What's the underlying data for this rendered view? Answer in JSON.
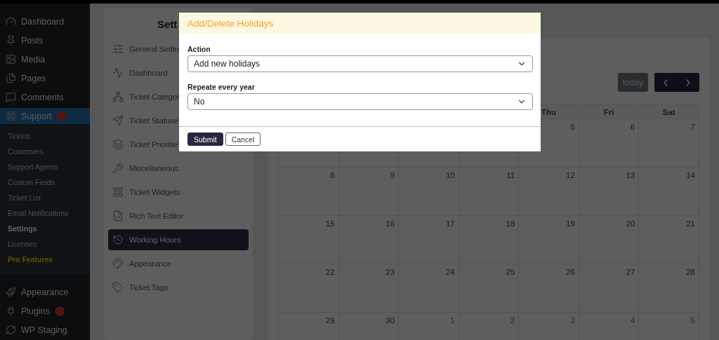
{
  "admin_menu": {
    "items": [
      {
        "label": "Dashboard",
        "kind": "top",
        "selected": false,
        "badge": false
      },
      {
        "label": "Posts",
        "kind": "top",
        "selected": false,
        "badge": false
      },
      {
        "label": "Media",
        "kind": "top",
        "selected": false,
        "badge": false
      },
      {
        "label": "Pages",
        "kind": "top",
        "selected": false,
        "badge": false
      },
      {
        "label": "Comments",
        "kind": "top",
        "selected": false,
        "badge": false
      },
      {
        "label": "Support",
        "kind": "top",
        "selected": true,
        "badge": true
      },
      {
        "label": "Tickets",
        "kind": "sub",
        "selected": false
      },
      {
        "label": "Customers",
        "kind": "sub",
        "selected": false
      },
      {
        "label": "Support Agents",
        "kind": "sub",
        "selected": false
      },
      {
        "label": "Custom Fields",
        "kind": "sub",
        "selected": false
      },
      {
        "label": "Ticket List",
        "kind": "sub",
        "selected": false
      },
      {
        "label": "Email Notifications",
        "kind": "sub",
        "selected": false
      },
      {
        "label": "Settings",
        "kind": "sub",
        "selected": true
      },
      {
        "label": "Licenses",
        "kind": "sub",
        "selected": false
      },
      {
        "label": "Pro Features",
        "kind": "pro",
        "selected": false
      },
      {
        "label": "Appearance",
        "kind": "top",
        "selected": false,
        "badge": false
      },
      {
        "label": "Plugins",
        "kind": "top",
        "selected": false,
        "badge": true
      },
      {
        "label": "WP Staging",
        "kind": "top",
        "selected": false,
        "badge": false
      }
    ]
  },
  "settings_panel": {
    "title": "Sett",
    "items": [
      {
        "label": "General Settin",
        "selected": false
      },
      {
        "label": "Dashboard",
        "selected": false
      },
      {
        "label": "Ticket Categor",
        "selected": false
      },
      {
        "label": "Ticket Statuse",
        "selected": false
      },
      {
        "label": "Ticket Prioritie",
        "selected": false
      },
      {
        "label": "Miscellaneous",
        "selected": false
      },
      {
        "label": "Ticket Widgets",
        "selected": false
      },
      {
        "label": "Rich Text Editor",
        "selected": false
      },
      {
        "label": "Working Hours",
        "selected": true
      },
      {
        "label": "Appearance",
        "selected": false
      },
      {
        "label": "Ticket Tags",
        "selected": false
      }
    ]
  },
  "calendar": {
    "today_button": "today",
    "weekdays": [
      "Thu",
      "Fri",
      "Sat"
    ],
    "weeks": [
      {
        "days": [
          {
            "label": "5",
            "faded": false
          },
          {
            "label": "6",
            "faded": false
          },
          {
            "label": "7",
            "faded": false
          }
        ]
      },
      {
        "days": [
          {
            "label": "8",
            "faded": false
          },
          {
            "label": "9",
            "faded": false
          },
          {
            "label": "10",
            "faded": false
          },
          {
            "label": "11",
            "faded": false
          },
          {
            "label": "12",
            "faded": false
          },
          {
            "label": "13",
            "faded": false
          },
          {
            "label": "14",
            "faded": false
          }
        ]
      },
      {
        "days": [
          {
            "label": "15",
            "faded": false
          },
          {
            "label": "16",
            "faded": false
          },
          {
            "label": "17",
            "faded": false
          },
          {
            "label": "18",
            "faded": false
          },
          {
            "label": "19",
            "faded": false
          },
          {
            "label": "20",
            "faded": false
          },
          {
            "label": "21",
            "faded": false
          }
        ]
      },
      {
        "days": [
          {
            "label": "22",
            "faded": false
          },
          {
            "label": "23",
            "faded": false
          },
          {
            "label": "24",
            "faded": false
          },
          {
            "label": "25",
            "faded": false
          },
          {
            "label": "26",
            "faded": false
          },
          {
            "label": "27",
            "faded": false
          },
          {
            "label": "28",
            "faded": false
          }
        ]
      },
      {
        "days": [
          {
            "label": "29",
            "faded": false
          },
          {
            "label": "30",
            "faded": false
          },
          {
            "label": "1",
            "faded": true
          },
          {
            "label": "2",
            "faded": true
          },
          {
            "label": "3",
            "faded": true
          },
          {
            "label": "4",
            "faded": true
          },
          {
            "label": "5",
            "faded": true
          }
        ]
      }
    ]
  },
  "dialog": {
    "title": "Add/Delete Holidays",
    "fields": [
      {
        "label": "Action",
        "value": "Add new holidays"
      },
      {
        "label": "Repeate every year",
        "value": "No"
      }
    ],
    "buttons": [
      {
        "label": "Submit",
        "kind": "primary"
      },
      {
        "label": "Cancel",
        "kind": "secondary"
      }
    ]
  }
}
